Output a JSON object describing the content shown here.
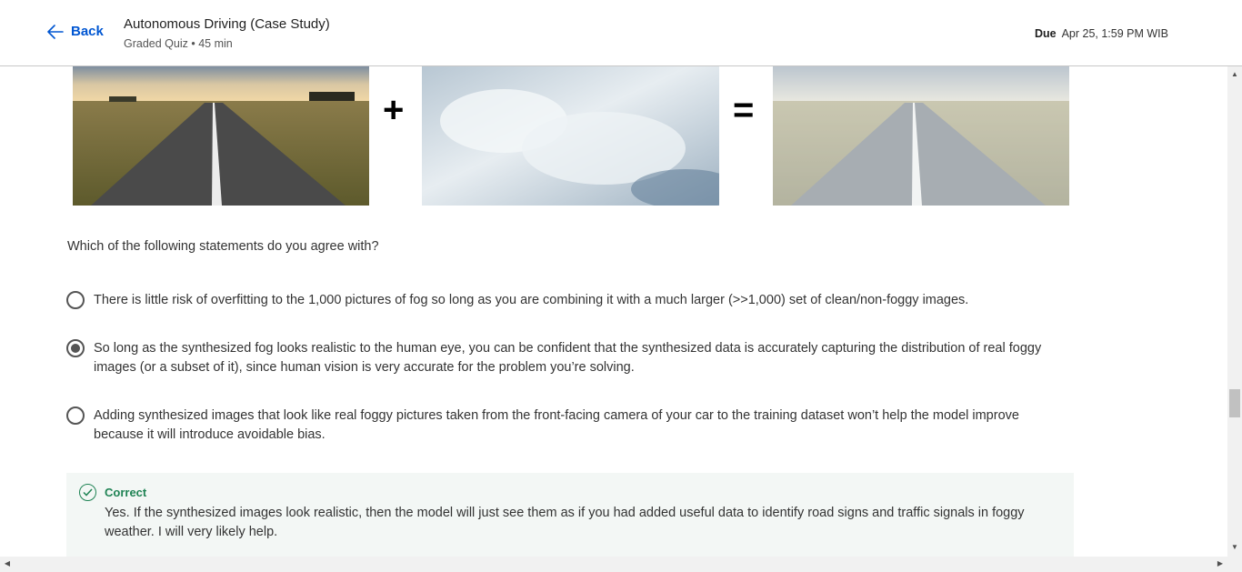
{
  "header": {
    "back_label": "Back",
    "title": "Autonomous Driving (Case Study)",
    "subtitle": "Graded Quiz • 45 min",
    "due_label": "Due",
    "due_value": "Apr 25, 1:59 PM WIB"
  },
  "figure": {
    "plus_symbol": "+",
    "equals_symbol": "="
  },
  "question": {
    "prompt": "Which of the following statements do you agree with?",
    "options": [
      {
        "text": "There is little risk of overfitting to the 1,000 pictures of fog so long as you are combining it with a much larger (>>1,000) set of clean/non-foggy images.",
        "selected": false
      },
      {
        "text": "So long as the synthesized fog looks realistic to the human eye, you can be confident that the synthesized data is accurately capturing the distribution of real foggy images (or a subset of it), since human vision is very accurate for the problem you’re solving.",
        "selected": true
      },
      {
        "text": "Adding synthesized images that look like real foggy pictures taken from the front-facing camera of your car to the training dataset won’t help the model improve because it will introduce avoidable bias.",
        "selected": false
      }
    ]
  },
  "feedback": {
    "status": "Correct",
    "text": "Yes. If the synthesized images look realistic, then the model will just see them as if you had added useful data to identify road signs and traffic signals in foggy weather. I will very likely help."
  },
  "colors": {
    "accent": "#0056d2",
    "correct": "#1f8354",
    "feedback_bg": "#f3f7f5"
  }
}
